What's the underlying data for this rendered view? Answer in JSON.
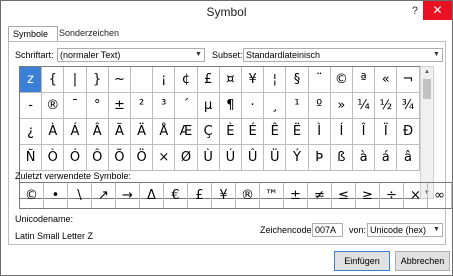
{
  "window": {
    "title": "Symbol",
    "help": "?",
    "close": "✕"
  },
  "tabs": [
    {
      "label": "Symbole"
    },
    {
      "label": "Sonderzeichen"
    }
  ],
  "font": {
    "label": "Schriftart:",
    "value": "(normaler Text)"
  },
  "subset": {
    "label": "Subset:",
    "value": "Standardlateinisch"
  },
  "grid_rows": [
    [
      "z",
      "{",
      "|",
      "}",
      "~",
      " ",
      "¡",
      "¢",
      "£",
      "¤",
      "¥",
      "¦",
      "§",
      "¨",
      "©",
      "ª",
      "«",
      "¬"
    ],
    [
      "-",
      "®",
      "¯",
      "°",
      "±",
      "²",
      "³",
      "´",
      "µ",
      "¶",
      "·",
      "¸",
      "¹",
      "º",
      "»",
      "¼",
      "½",
      "¾"
    ],
    [
      "¿",
      "À",
      "Á",
      "Â",
      "Ã",
      "Ä",
      "Å",
      "Æ",
      "Ç",
      "È",
      "É",
      "Ê",
      "Ë",
      "Ì",
      "Í",
      "Î",
      "Ï",
      "Đ"
    ],
    [
      "Ñ",
      "Ò",
      "Ó",
      "Ô",
      "Õ",
      "Ö",
      "×",
      "Ø",
      "Ù",
      "Ú",
      "Û",
      "Ü",
      "Ý",
      "Þ",
      "ß",
      "à",
      "á",
      "â"
    ]
  ],
  "recent": {
    "label": "Zuletzt verwendete Symbole:",
    "symbols": [
      "©",
      "•",
      "\\",
      "↗",
      "→",
      "Δ",
      "€",
      "£",
      "¥",
      "®",
      "™",
      "±",
      "≠",
      "≤",
      "≥",
      "÷",
      "×",
      "∞"
    ]
  },
  "unicode_name": {
    "label": "Unicodename:",
    "value": "Latin Small Letter Z"
  },
  "charcode": {
    "label": "Zeichencode:",
    "value": "007A"
  },
  "from": {
    "label": "von:",
    "value": "Unicode (hex)"
  },
  "buttons": {
    "insert": "Einfügen",
    "cancel": "Abbrechen"
  }
}
